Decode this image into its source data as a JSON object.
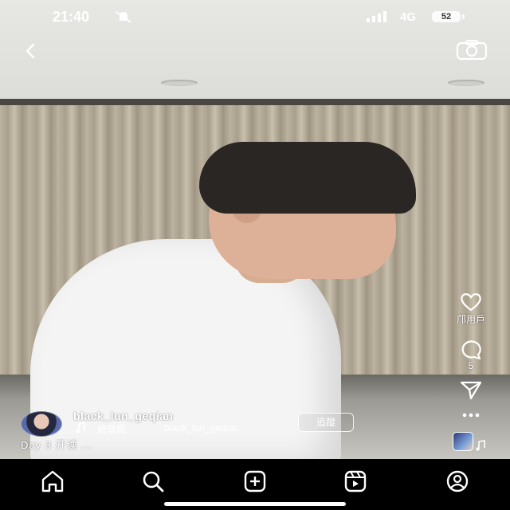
{
  "status_bar": {
    "time": "21:40",
    "network": "4G",
    "battery": "52"
  },
  "post": {
    "username": "black_lun_geqian",
    "audio_label": "始音訊",
    "audio_user": "black_lun_geqian",
    "follow_label": "追蹤",
    "caption": "Day 3 开读 ..."
  },
  "side_actions": {
    "like_label": "邝用戶",
    "comment_count": "5"
  },
  "icons": [
    "back-icon",
    "camera-icon",
    "heart-icon",
    "comment-icon",
    "share-icon",
    "more-icon",
    "music-note-icon",
    "home-icon",
    "search-icon",
    "create-icon",
    "reels-icon",
    "profile-icon"
  ],
  "colors": {
    "background": "#000000",
    "text": "#ffffff"
  }
}
